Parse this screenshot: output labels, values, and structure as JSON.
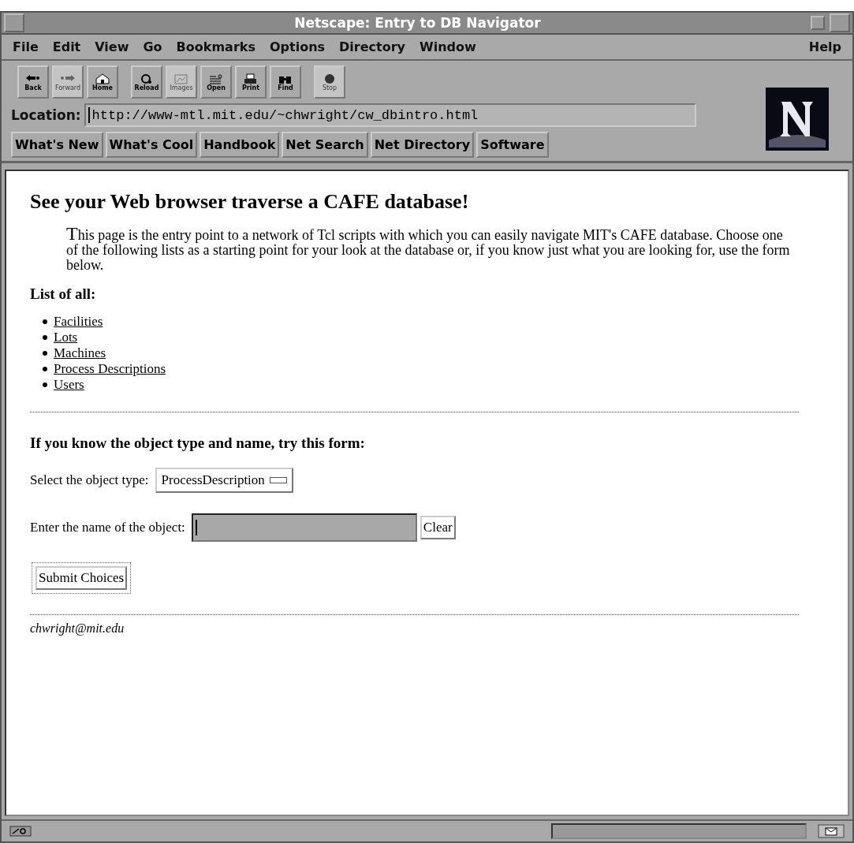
{
  "window": {
    "title": "Netscape: Entry to DB Navigator"
  },
  "menu": [
    {
      "label": "File"
    },
    {
      "label": "Edit"
    },
    {
      "label": "View"
    },
    {
      "label": "Go"
    },
    {
      "label": "Bookmarks"
    },
    {
      "label": "Options"
    },
    {
      "label": "Directory"
    },
    {
      "label": "Window"
    },
    {
      "label": "Help",
      "kind": "right"
    }
  ],
  "toolbar": [
    {
      "label": "Back",
      "disabled": false
    },
    {
      "label": "Forward",
      "disabled": true
    },
    {
      "label": "Home",
      "disabled": false
    },
    {
      "label": "Reload",
      "disabled": false
    },
    {
      "label": "Images",
      "disabled": true
    },
    {
      "label": "Open",
      "disabled": false
    },
    {
      "label": "Print",
      "disabled": false
    },
    {
      "label": "Find",
      "disabled": false
    },
    {
      "label": "Stop",
      "disabled": true
    }
  ],
  "location": {
    "label": "Location:",
    "value": "http://www-mtl.mit.edu/~chwright/cw_dbintro.html"
  },
  "directory_buttons": [
    "What's New",
    "What's Cool",
    "Handbook",
    "Net Search",
    "Net Directory",
    "Software"
  ],
  "page": {
    "heading": "See your Web browser traverse a CAFE database!",
    "intro": "This page is the entry point to a network of Tcl scripts with which you can easily navigate MIT's CAFE database. Choose one of the following lists as a starting point for your look at the database or, if you know just what you are looking for, use the form below.",
    "list_heading": "List of all:",
    "links": [
      "Facilities",
      "Lots",
      "Machines",
      "Process Descriptions",
      "Users"
    ],
    "form_heading": "If you know the object type and name, try this form:",
    "type_label": "Select the object type:",
    "type_value": "ProcessDescription",
    "name_label": "Enter the name of the object:",
    "clear_button": "Clear",
    "submit_button": "Submit Choices",
    "footer": "chwright@mit.edu"
  }
}
